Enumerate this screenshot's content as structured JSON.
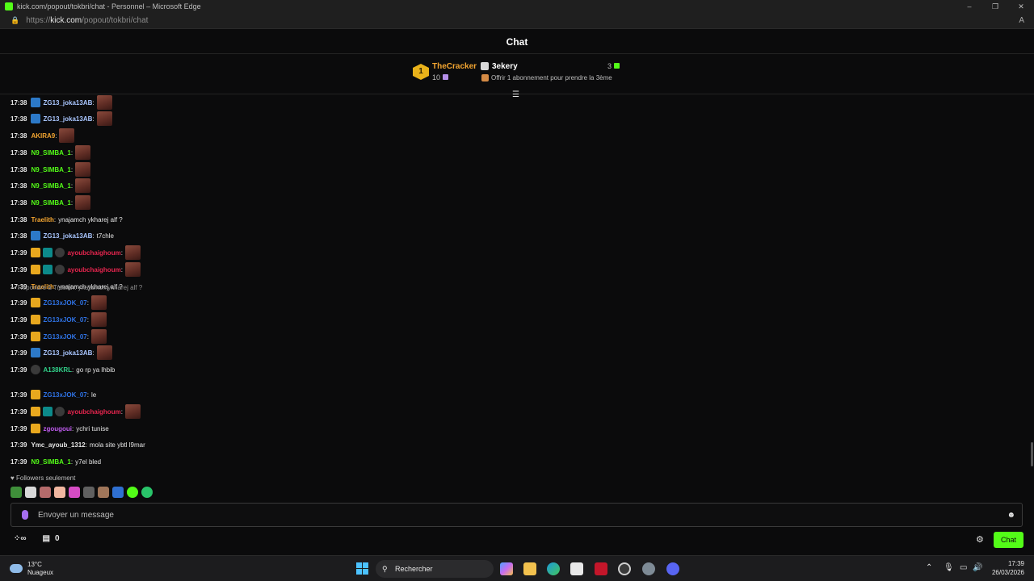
{
  "window": {
    "title": "kick.com/popout/tokbri/chat - Personnel – Microsoft Edge",
    "url_prefix": "https://",
    "url_domain": "kick.com",
    "url_path": "/popout/tokbri/chat"
  },
  "chat": {
    "title": "Chat",
    "leaderboard": {
      "rank": "1",
      "first_name": "TheCracker",
      "first_count": "10",
      "second_name": "3ekery",
      "second_count": "3",
      "offer_text": "Offrir 1 abonnement pour prendre la 3ème"
    },
    "messages": [
      {
        "time": "17:38",
        "user": "ZG13_joka13AB",
        "color": "#a9c6ff",
        "badges": [
          "sub"
        ],
        "text": "",
        "emote": true
      },
      {
        "time": "17:38",
        "user": "ZG13_joka13AB",
        "color": "#a9c6ff",
        "badges": [
          "sub"
        ],
        "text": "",
        "emote": true
      },
      {
        "time": "17:38",
        "user": "AKIRA9",
        "color": "#f3a531",
        "badges": [],
        "text": "",
        "emote": true
      },
      {
        "time": "17:38",
        "user": "N9_SIMBA_1",
        "color": "#53fc18",
        "badges": [],
        "text": "",
        "emote": true
      },
      {
        "time": "17:38",
        "user": "N9_SIMBA_1",
        "color": "#53fc18",
        "badges": [],
        "text": "",
        "emote": true
      },
      {
        "time": "17:38",
        "user": "N9_SIMBA_1",
        "color": "#53fc18",
        "badges": [],
        "text": "",
        "emote": true
      },
      {
        "time": "17:38",
        "user": "N9_SIMBA_1",
        "color": "#53fc18",
        "badges": [],
        "text": "",
        "emote": true
      },
      {
        "time": "17:38",
        "user": "Traelith",
        "color": "#f3a531",
        "badges": [],
        "text": "ynajamch ykharej alf ?",
        "emote": false
      },
      {
        "time": "17:38",
        "user": "ZG13_joka13AB",
        "color": "#a9c6ff",
        "badges": [
          "sub"
        ],
        "text": "t7chle",
        "emote": false
      },
      {
        "time": "17:39",
        "user": "ayoubchaighoum",
        "color": "#e5254e",
        "badges": [
          "crown",
          "og",
          "person"
        ],
        "text": "",
        "emote": true
      },
      {
        "time": "17:39",
        "user": "ayoubchaighoum",
        "color": "#e5254e",
        "badges": [
          "crown",
          "og",
          "person"
        ],
        "text": "",
        "emote": true
      },
      {
        "time": "17:39",
        "user": "Traelith",
        "color": "#f3a531",
        "badges": [],
        "text": "ynajamch ykharej alf ?",
        "emote": false
      },
      {
        "time": "17:39",
        "user": "ZG13xJOK_07",
        "color": "#2f73e6",
        "badges": [
          "crown"
        ],
        "text": "",
        "emote": true
      },
      {
        "time": "17:39",
        "user": "ZG13xJOK_07",
        "color": "#2f73e6",
        "badges": [
          "crown"
        ],
        "text": "",
        "emote": true
      },
      {
        "time": "17:39",
        "user": "ZG13xJOK_07",
        "color": "#2f73e6",
        "badges": [
          "crown"
        ],
        "text": "",
        "emote": true
      },
      {
        "time": "17:39",
        "user": "ZG13_joka13AB",
        "color": "#a9c6ff",
        "badges": [
          "sub"
        ],
        "text": "",
        "emote": true
      },
      {
        "time": "17:39",
        "user": "A138KRL",
        "color": "#31d18a",
        "badges": [
          "person"
        ],
        "text": "go rp ya lhbib",
        "emote": false
      },
      {
        "time": "17:39",
        "user": "ZG13xJOK_07",
        "color": "#2f73e6",
        "badges": [
          "crown"
        ],
        "text": "le",
        "emote": false
      },
      {
        "time": "17:39",
        "user": "ayoubchaighoum",
        "color": "#e5254e",
        "badges": [
          "crown",
          "og",
          "person"
        ],
        "text": "",
        "emote": true
      },
      {
        "time": "17:39",
        "user": "zgougoui",
        "color": "#c05cf0",
        "badges": [
          "crown"
        ],
        "text": "ychri tunise",
        "emote": false
      },
      {
        "time": "17:39",
        "user": "Ymc_ayoub_1312",
        "color": "#e6e6e6",
        "badges": [],
        "text": "mola site ybtl l9mar",
        "emote": false
      },
      {
        "time": "17:39",
        "user": "N9_SIMBA_1",
        "color": "#53fc18",
        "badges": [],
        "text": "y7el bled",
        "emote": false
      }
    ],
    "reply_context": "Répondre à Traelith: ynajamch ykharej alf ?",
    "followers_only": "Followers seulement",
    "input_placeholder": "Envoyer un message",
    "bottom_count": "0",
    "send_label": "Chat"
  },
  "taskbar": {
    "temp": "13°C",
    "weather": "Nuageux",
    "search_label": "Rechercher",
    "time": "17:39",
    "date": "26/03/2026"
  }
}
